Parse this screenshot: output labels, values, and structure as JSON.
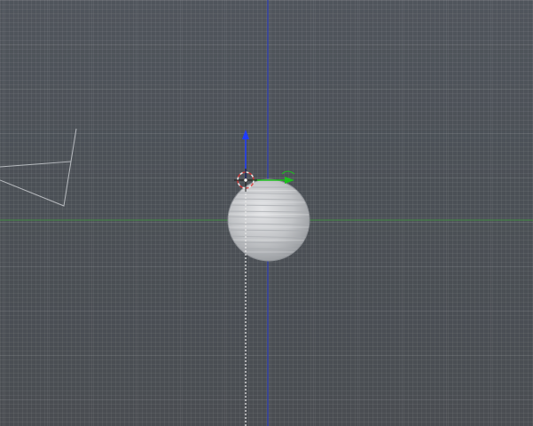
{
  "viewport": {
    "view": "3d-viewport-side-view",
    "colors": {
      "background_top": "#50555c",
      "background_bottom": "#4a4d52",
      "x_axis_line": "#3f9a3f",
      "z_axis_line": "#2e3fb8",
      "camera_lines": "#c9ccd0",
      "sphere": "#c9cbcd",
      "manipulator_z": "#1f3cff",
      "manipulator_y": "#1dbf1d",
      "cursor_3d": "#e8e8e8"
    },
    "objects": {
      "sphere": "uv-sphere-mesh",
      "camera": "camera-object",
      "cursor": "3d-cursor-icon",
      "manipulator": "transform-manipulator-widget"
    }
  }
}
